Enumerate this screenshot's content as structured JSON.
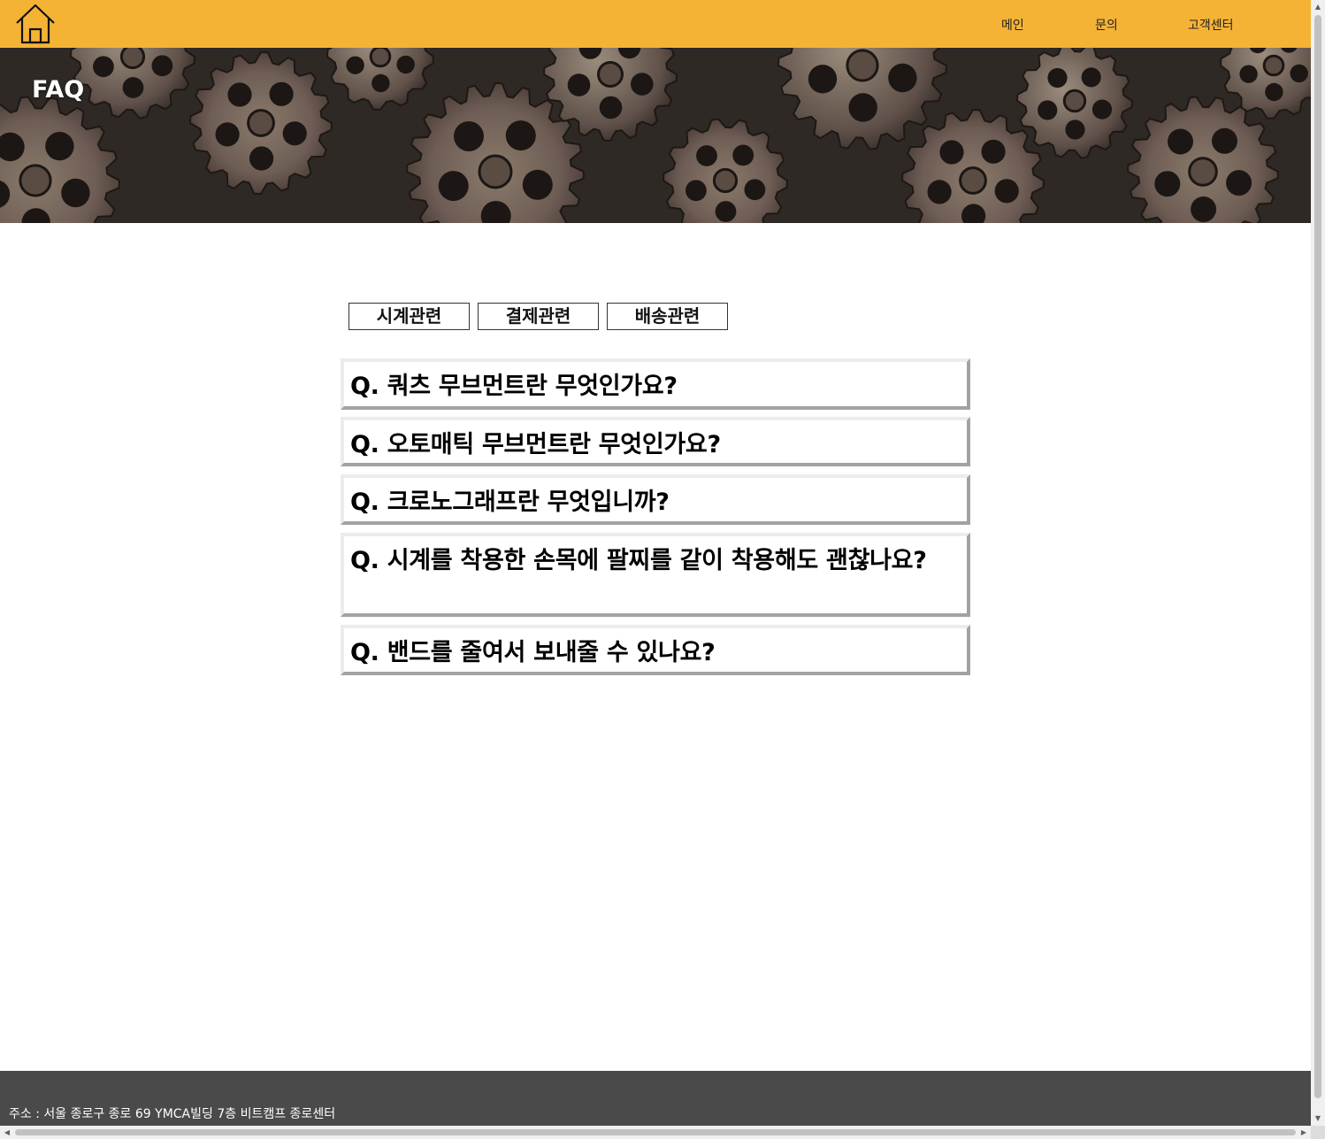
{
  "header": {
    "home_icon": "home-icon",
    "nav": [
      {
        "label": "메인"
      },
      {
        "label": "문의"
      },
      {
        "label": "고객센터"
      }
    ]
  },
  "banner": {
    "title": "FAQ"
  },
  "categories": [
    {
      "label": "시계관련"
    },
    {
      "label": "결제관련"
    },
    {
      "label": "배송관련"
    }
  ],
  "faq": [
    {
      "question": "Q. 쿼츠 무브먼트란 무엇인가요?"
    },
    {
      "question": "Q. 오토매틱 무브먼트란 무엇인가요?"
    },
    {
      "question": "Q. 크로노그래프란 무엇입니까?"
    },
    {
      "question": "Q. 시계를 착용한 손목에 팔찌를 같이 착용해도 괜찮나요?"
    },
    {
      "question": "Q. 밴드를 줄여서 보내줄 수 있나요?"
    }
  ],
  "footer": {
    "address": "주소 : 서울 종로구 종로 69 YMCA빌딩 7층 비트캠프 종로센터"
  },
  "colors": {
    "header_bg": "#f5b335",
    "footer_bg": "#4a4a4a"
  }
}
